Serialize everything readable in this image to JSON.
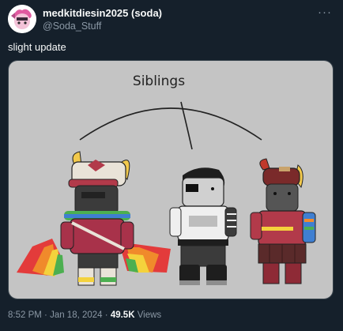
{
  "author": {
    "display_name": "medkitdiesin2025 (soda)",
    "handle": "@Soda_Stuff",
    "avatar_icon": "pink-character-avatar-icon"
  },
  "more_icon": "more-dots-icon",
  "tweet": {
    "text": "slight update"
  },
  "image": {
    "caption": "Siblings",
    "background": "#c4c4c4"
  },
  "meta": {
    "time": "8:52 PM",
    "separator1": " · ",
    "date": "Jan 18, 2024",
    "separator2": " · ",
    "views_count": "49.5K",
    "views_label": " Views"
  },
  "colors": {
    "background": "#15202b",
    "text": "#f7f9f9",
    "secondary_text": "#8b98a5",
    "border": "#38444d"
  }
}
